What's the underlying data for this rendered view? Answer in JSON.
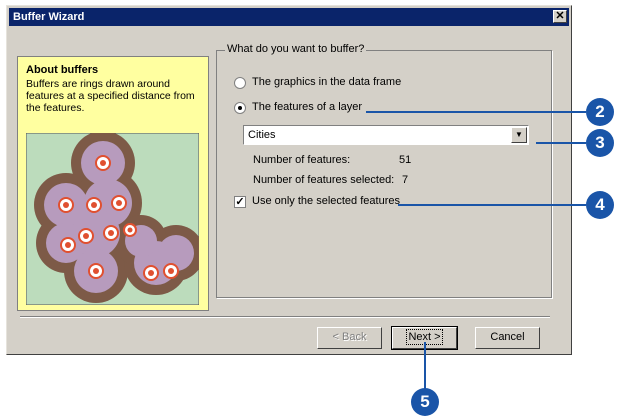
{
  "window": {
    "title": "Buffer Wizard",
    "close_glyph": "✕"
  },
  "about": {
    "title": "About buffers",
    "text": "Buffers are rings drawn around features at a specified distance from the features.",
    "illustration": "buffer-rings-illustration"
  },
  "group": {
    "title": "What do you want to buffer?",
    "options": [
      {
        "label": "The graphics in the data frame",
        "checked": false
      },
      {
        "label": "The features of a layer",
        "checked": true
      }
    ],
    "layer_select": {
      "value": "Cities"
    },
    "stats": [
      {
        "label": "Number of features:",
        "value": "51"
      },
      {
        "label": "Number of features selected:",
        "value": "7"
      }
    ],
    "selected_only": {
      "label": "Use only the selected features",
      "checked": true
    }
  },
  "buttons": {
    "back": "< Back",
    "next": "Next >",
    "cancel": "Cancel"
  },
  "callouts": [
    "2",
    "3",
    "4",
    "5"
  ],
  "colors": {
    "callout": "#1a55a8",
    "titlebar": "#0a246a",
    "about_bg": "#ffffa0"
  }
}
